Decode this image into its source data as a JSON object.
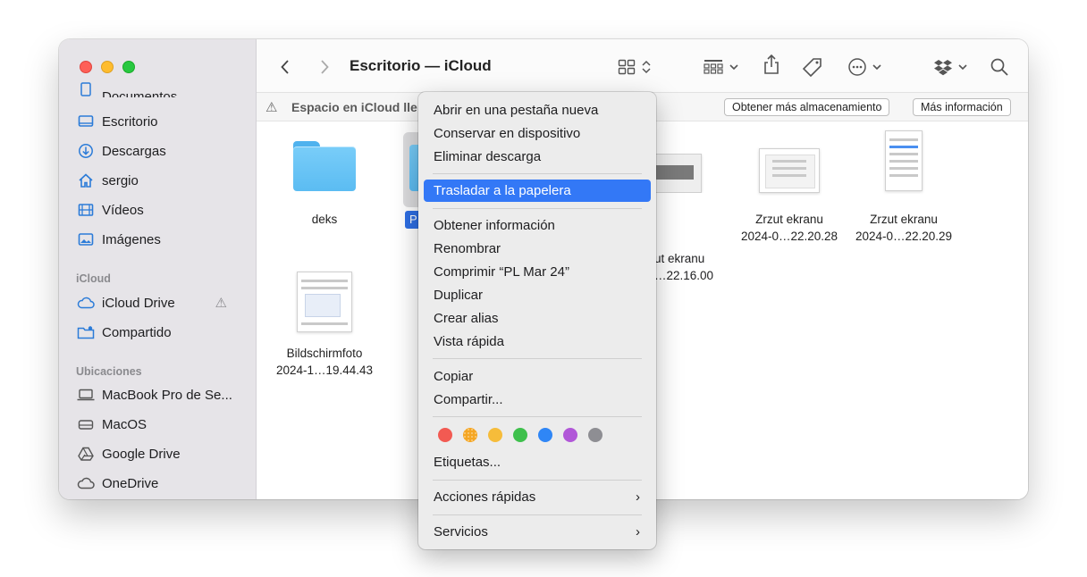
{
  "window": {
    "title": "Escritorio — iCloud"
  },
  "sidebar": {
    "partial_item": "Documentos",
    "favorites": [
      {
        "label": "Escritorio",
        "icon": "desktop-icon"
      },
      {
        "label": "Descargas",
        "icon": "download-icon"
      },
      {
        "label": "sergio",
        "icon": "home-icon"
      },
      {
        "label": "Vídeos",
        "icon": "film-icon"
      },
      {
        "label": "Imágenes",
        "icon": "photo-icon"
      }
    ],
    "icloud_heading": "iCloud",
    "icloud_items": [
      {
        "label": "iCloud Drive",
        "icon": "cloud-icon"
      },
      {
        "label": "Compartido",
        "icon": "shared-folder-icon"
      }
    ],
    "locations_heading": "Ubicaciones",
    "locations": [
      {
        "label": "MacBook Pro de Se...",
        "icon": "laptop-icon"
      },
      {
        "label": "MacOS",
        "icon": "disk-icon"
      },
      {
        "label": "Google Drive",
        "icon": "google-drive-icon"
      },
      {
        "label": "OneDrive",
        "icon": "cloud-icon"
      }
    ]
  },
  "banner": {
    "text": "Espacio en iCloud lle",
    "more_storage_label": "Obtener más almacenamiento",
    "more_info_label": "Más información"
  },
  "files": [
    {
      "name_line1": "deks",
      "name_line2": ""
    },
    {
      "name_line1": "P",
      "name_line2": ""
    },
    {
      "name_line1": "ut ekranu",
      "name_line2": "…22.16.00"
    },
    {
      "name_line1": "Zrzut ekranu",
      "name_line2": "2024-0…22.20.28"
    },
    {
      "name_line1": "Zrzut ekranu",
      "name_line2": "2024-0…22.20.29"
    },
    {
      "name_line1": "Bildschirmfoto",
      "name_line2": "2024-1…19.44.43"
    }
  ],
  "context_menu": {
    "items_group1": [
      "Abrir en una pestaña nueva",
      "Conservar en dispositivo",
      "Eliminar descarga"
    ],
    "highlighted": "Trasladar a la papelera",
    "items_group2": [
      "Obtener información",
      "Renombrar",
      "Comprimir “PL Mar 24”",
      "Duplicar",
      "Crear alias",
      "Vista rápida"
    ],
    "items_group3": [
      "Copiar",
      "Compartir..."
    ],
    "tag_colors": [
      "#f25a52",
      "#f5a623",
      "#f6bc3a",
      "#3ec04c",
      "#2f86f6",
      "#b157d8",
      "#8e8e93"
    ],
    "tags_label": "Etiquetas...",
    "quick_actions": "Acciones rápidas",
    "services": "Servicios",
    "submenu_arrow": "›"
  }
}
